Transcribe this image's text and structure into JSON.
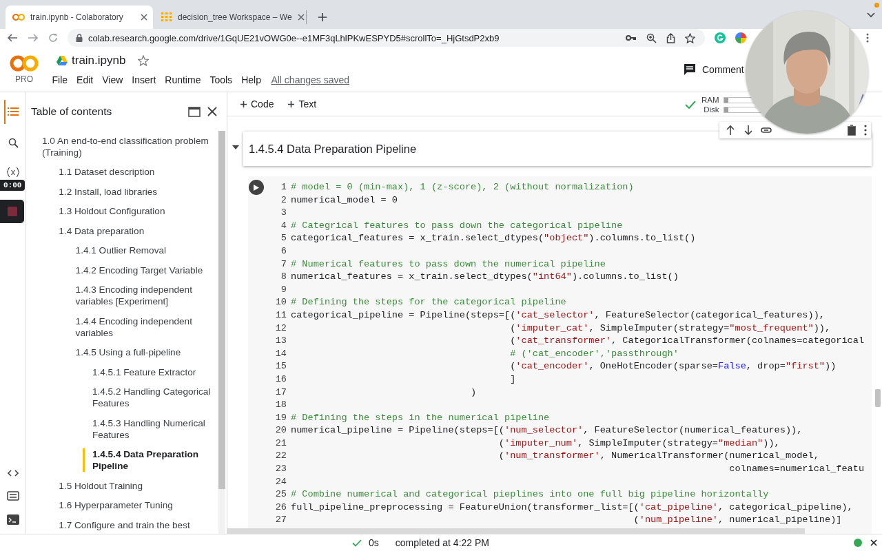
{
  "browser": {
    "tabs": [
      {
        "title": "train.ipynb - Colaboratory",
        "selected": true
      },
      {
        "title": "decision_tree Workspace – We",
        "selected": false
      }
    ],
    "url": "colab.research.google.com/drive/1GqUE21vOWG0e--e1MF3qLhlPKwESPYD5#scrollTo=_HjGtsdP2xb9"
  },
  "notebook_header": {
    "logo_label": "PRO",
    "title": "train.ipynb",
    "menu": [
      "File",
      "Edit",
      "View",
      "Insert",
      "Runtime",
      "Tools",
      "Help"
    ],
    "save_status": "All changes saved",
    "comment_button": "Comment"
  },
  "toolbar": {
    "add_buttons": [
      "Code",
      "Text"
    ],
    "resources": [
      {
        "label": "RAM",
        "level": 0.1
      },
      {
        "label": "Disk",
        "level": 0.1
      }
    ]
  },
  "recorder": {
    "timer": "0:00"
  },
  "toc": {
    "title": "Table of contents",
    "items": [
      {
        "label": "1.0 An end-to-end classification problem (Training)",
        "selected": false,
        "children": [
          {
            "label": "1.1 Dataset description",
            "selected": false
          },
          {
            "label": "1.2 Install, load libraries",
            "selected": false
          },
          {
            "label": "1.3 Holdout Configuration",
            "selected": false
          },
          {
            "label": "1.4 Data preparation",
            "selected": false,
            "children": [
              {
                "label": "1.4.1 Outlier Removal",
                "selected": false
              },
              {
                "label": "1.4.2 Encoding Target Variable",
                "selected": false
              },
              {
                "label": "1.4.3 Encoding independent variables [Experiment]",
                "selected": false
              },
              {
                "label": "1.4.4 Encoding independent variables",
                "selected": false
              },
              {
                "label": "1.4.5 Using a full-pipeline",
                "selected": false,
                "children": [
                  {
                    "label": "1.4.5.1 Feature Extractor",
                    "selected": false
                  },
                  {
                    "label": "1.4.5.2 Handling Categorical Features",
                    "selected": false
                  },
                  {
                    "label": "1.4.5.3 Handling Numerical Features",
                    "selected": false
                  },
                  {
                    "label": "1.4.5.4 Data Preparation Pipeline",
                    "selected": true
                  }
                ]
              }
            ]
          },
          {
            "label": "1.5 Holdout Training",
            "selected": false
          },
          {
            "label": "1.6 Hyperparameter Tuning",
            "selected": false
          },
          {
            "label": "1.7 Configure and train the best",
            "selected": false
          }
        ]
      }
    ]
  },
  "section": {
    "heading": "1.4.5.4 Data Preparation Pipeline",
    "expanded": true
  },
  "code_cell": {
    "lines": [
      {
        "number": "1",
        "tokens": [
          {
            "kind": "comment",
            "text": "# model = 0 (min-max), 1 (z-score), 2 (without normalization)"
          }
        ]
      },
      {
        "number": "2",
        "tokens": [
          {
            "kind": "plain",
            "text": "numerical_model = 0"
          }
        ]
      },
      {
        "number": "3"
      },
      {
        "number": "4",
        "tokens": [
          {
            "kind": "comment",
            "text": "# Categrical features to pass down the categorical pipeline"
          }
        ]
      },
      {
        "number": "5",
        "tokens": [
          {
            "kind": "plain",
            "text": "categorical_features = x_train.select_dtypes("
          },
          {
            "kind": "string",
            "text": "\"object\""
          },
          {
            "kind": "plain",
            "text": ").columns.to_list()"
          }
        ]
      },
      {
        "number": "6"
      },
      {
        "number": "7",
        "tokens": [
          {
            "kind": "comment",
            "text": "# Numerical features to pass down the numerical pipeline"
          }
        ]
      },
      {
        "number": "8",
        "tokens": [
          {
            "kind": "plain",
            "text": "numerical_features = x_train.select_dtypes("
          },
          {
            "kind": "string",
            "text": "\"int64\""
          },
          {
            "kind": "plain",
            "text": ").columns.to_list()"
          }
        ]
      },
      {
        "number": "9"
      },
      {
        "number": "10",
        "tokens": [
          {
            "kind": "comment",
            "text": "# Defining the steps for the categorical pipeline"
          }
        ]
      },
      {
        "number": "11",
        "tokens": [
          {
            "kind": "plain",
            "text": "categorical_pipeline = Pipeline(steps=[("
          },
          {
            "kind": "string",
            "text": "'cat_selector'"
          },
          {
            "kind": "plain",
            "text": ", FeatureSelector(categorical_features)),"
          }
        ]
      },
      {
        "number": "12",
        "tokens": [
          {
            "kind": "plain",
            "text": "                                       ("
          },
          {
            "kind": "string",
            "text": "'imputer_cat'"
          },
          {
            "kind": "plain",
            "text": ", SimpleImputer(strategy="
          },
          {
            "kind": "string",
            "text": "\"most_frequent\""
          },
          {
            "kind": "plain",
            "text": ")),"
          }
        ]
      },
      {
        "number": "13",
        "tokens": [
          {
            "kind": "plain",
            "text": "                                       ("
          },
          {
            "kind": "string",
            "text": "'cat_transformer'"
          },
          {
            "kind": "plain",
            "text": ", CategoricalTransformer(colnames=categorical"
          }
        ]
      },
      {
        "number": "14",
        "tokens": [
          {
            "kind": "comment",
            "text": "                                       # ('cat_encoder','passthrough'"
          }
        ]
      },
      {
        "number": "15",
        "tokens": [
          {
            "kind": "plain",
            "text": "                                       ("
          },
          {
            "kind": "string",
            "text": "'cat_encoder'"
          },
          {
            "kind": "plain",
            "text": ", OneHotEncoder(sparse="
          },
          {
            "kind": "keyword",
            "text": "False"
          },
          {
            "kind": "plain",
            "text": ", drop="
          },
          {
            "kind": "string",
            "text": "\"first\""
          },
          {
            "kind": "plain",
            "text": "))"
          }
        ]
      },
      {
        "number": "16",
        "tokens": [
          {
            "kind": "plain",
            "text": "                                       ]"
          }
        ]
      },
      {
        "number": "17",
        "tokens": [
          {
            "kind": "plain",
            "text": "                                )"
          }
        ]
      },
      {
        "number": "18"
      },
      {
        "number": "19",
        "tokens": [
          {
            "kind": "comment",
            "text": "# Defining the steps in the numerical pipeline"
          }
        ]
      },
      {
        "number": "20",
        "tokens": [
          {
            "kind": "plain",
            "text": "numerical_pipeline = Pipeline(steps=[("
          },
          {
            "kind": "string",
            "text": "'num_selector'"
          },
          {
            "kind": "plain",
            "text": ", FeatureSelector(numerical_features)),"
          }
        ]
      },
      {
        "number": "21",
        "tokens": [
          {
            "kind": "plain",
            "text": "                                     ("
          },
          {
            "kind": "string",
            "text": "'imputer_num'"
          },
          {
            "kind": "plain",
            "text": ", SimpleImputer(strategy="
          },
          {
            "kind": "string",
            "text": "\"median\""
          },
          {
            "kind": "plain",
            "text": ")),"
          }
        ]
      },
      {
        "number": "22",
        "tokens": [
          {
            "kind": "plain",
            "text": "                                     ("
          },
          {
            "kind": "string",
            "text": "'num_transformer'"
          },
          {
            "kind": "plain",
            "text": ", NumericalTransformer(numerical_model,"
          }
        ]
      },
      {
        "number": "23",
        "tokens": [
          {
            "kind": "plain",
            "text": "                                                                              colnames=numerical_featu"
          }
        ]
      },
      {
        "number": "24"
      },
      {
        "number": "25",
        "tokens": [
          {
            "kind": "comment",
            "text": "# Combine numerical and categorical pieplines into one full big pipeline horizontally"
          }
        ]
      },
      {
        "number": "26",
        "tokens": [
          {
            "kind": "plain",
            "text": "full_pipeline_preprocessing = FeatureUnion(transformer_list=[("
          },
          {
            "kind": "string",
            "text": "'cat_pipeline'"
          },
          {
            "kind": "plain",
            "text": ", categorical_pipeline),"
          }
        ]
      },
      {
        "number": "27",
        "tokens": [
          {
            "kind": "plain",
            "text": "                                                             ("
          },
          {
            "kind": "string",
            "text": "'num_pipeline'"
          },
          {
            "kind": "plain",
            "text": ", numerical_pipeline)]"
          }
        ]
      }
    ]
  },
  "status_bar": {
    "duration": "0s",
    "message": "completed at 4:22 PM"
  }
}
